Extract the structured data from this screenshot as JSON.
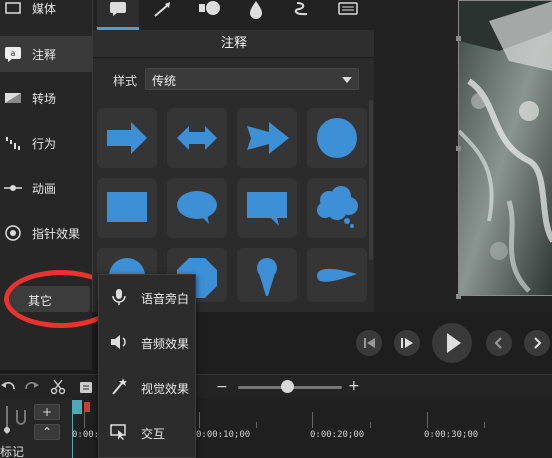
{
  "sidebar": {
    "items": [
      {
        "label": "媒体",
        "icon": "media-icon"
      },
      {
        "label": "注释",
        "icon": "annotation-icon"
      },
      {
        "label": "转场",
        "icon": "transition-icon"
      },
      {
        "label": "行为",
        "icon": "behavior-icon"
      },
      {
        "label": "动画",
        "icon": "animation-icon"
      },
      {
        "label": "指针效果",
        "icon": "cursor-effect-icon"
      }
    ],
    "more_label": "其它"
  },
  "panel": {
    "title": "注释",
    "style_label": "样式",
    "style_value": "传统",
    "tabs": [
      "callout-tab-icon",
      "arrow-tab-icon",
      "shape-tab-icon",
      "blur-tab-icon",
      "sketch-tab-icon",
      "keystroke-tab-icon"
    ],
    "shapes": [
      "arrow-right-icon",
      "arrow-double-icon",
      "arrow-fat-right-icon",
      "circle-icon",
      "rectangle-icon",
      "oval-speech-bubble-icon",
      "rect-speech-bubble-icon",
      "thought-cloud-icon",
      "circle-partial-icon",
      "octagon-icon",
      "pin-icon",
      "teardrop-icon"
    ]
  },
  "submenu": {
    "items": [
      {
        "label": "语音旁白",
        "icon": "microphone-icon"
      },
      {
        "label": "音频效果",
        "icon": "speaker-icon"
      },
      {
        "label": "视觉效果",
        "icon": "magic-wand-icon"
      },
      {
        "label": "交互",
        "icon": "interactive-icon"
      }
    ]
  },
  "timeline": {
    "zoom_minus": "−",
    "zoom_plus": "+",
    "zoom_level": 0.48,
    "add_track": "+",
    "collapse": "⌃",
    "marker_label": "标记",
    "ticks": [
      "0:00:00",
      "0:00:10;00",
      "0:00:20;00",
      "0:00:30;00"
    ]
  },
  "colors": {
    "accent": "#4a9fd8",
    "shape_fill": "#3d8fd6",
    "highlight_ring": "#e8332e",
    "playhead": "#4fa8b8"
  }
}
